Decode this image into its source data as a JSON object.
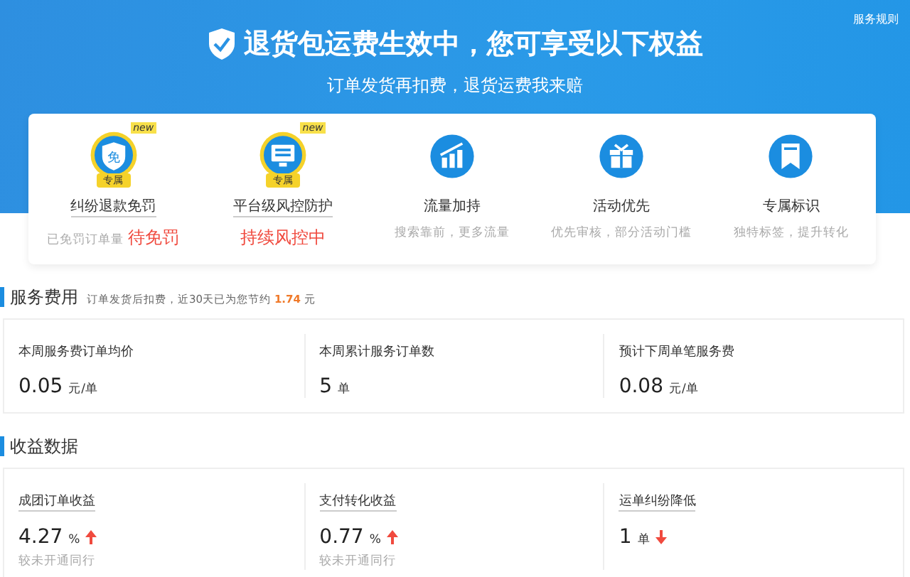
{
  "header": {
    "rules_link": "服务规则",
    "title": "退货包运费生效中，您可享受以下权益",
    "subtitle": "订单发货再扣费，退货运费我来赔"
  },
  "benefits": [
    {
      "kind": "exclusive",
      "tag": "new",
      "ribbon": "专属",
      "icon_text": "免",
      "label": "纠纷退款免罚",
      "desc": "已免罚订单量",
      "status": "待免罚"
    },
    {
      "kind": "exclusive",
      "tag": "new",
      "ribbon": "专属",
      "label": "平台级风控防护",
      "status": "持续风控中"
    },
    {
      "kind": "standard",
      "label": "流量加持",
      "desc": "搜索靠前，更多流量"
    },
    {
      "kind": "standard",
      "label": "活动优先",
      "desc": "优先审核，部分活动门槛"
    },
    {
      "kind": "standard",
      "label": "专属标识",
      "desc": "独特标签，提升转化"
    }
  ],
  "service_fee": {
    "title": "服务费用",
    "note": "订单发货后扣费，近30天已为您节约",
    "amount": "1.74",
    "amount_unit": "元",
    "cards": [
      {
        "label": "本周服务费订单均价",
        "value": "0.05",
        "unit": "元/单"
      },
      {
        "label": "本周累计服务订单数",
        "value": "5",
        "unit": "单"
      },
      {
        "label": "预计下周单笔服务费",
        "value": "0.08",
        "unit": "元/单"
      }
    ]
  },
  "earnings": {
    "title": "收益数据",
    "cards": [
      {
        "label": "成团订单收益",
        "value": "4.27",
        "unit": "%",
        "rising": true,
        "compare": "较未开通同行"
      },
      {
        "label": "支付转化收益",
        "value": "0.77",
        "unit": "%",
        "rising": true,
        "compare": "较未开通同行"
      },
      {
        "label": "运单纠纷降低",
        "value": "1",
        "unit": "单",
        "rising": false
      }
    ]
  }
}
